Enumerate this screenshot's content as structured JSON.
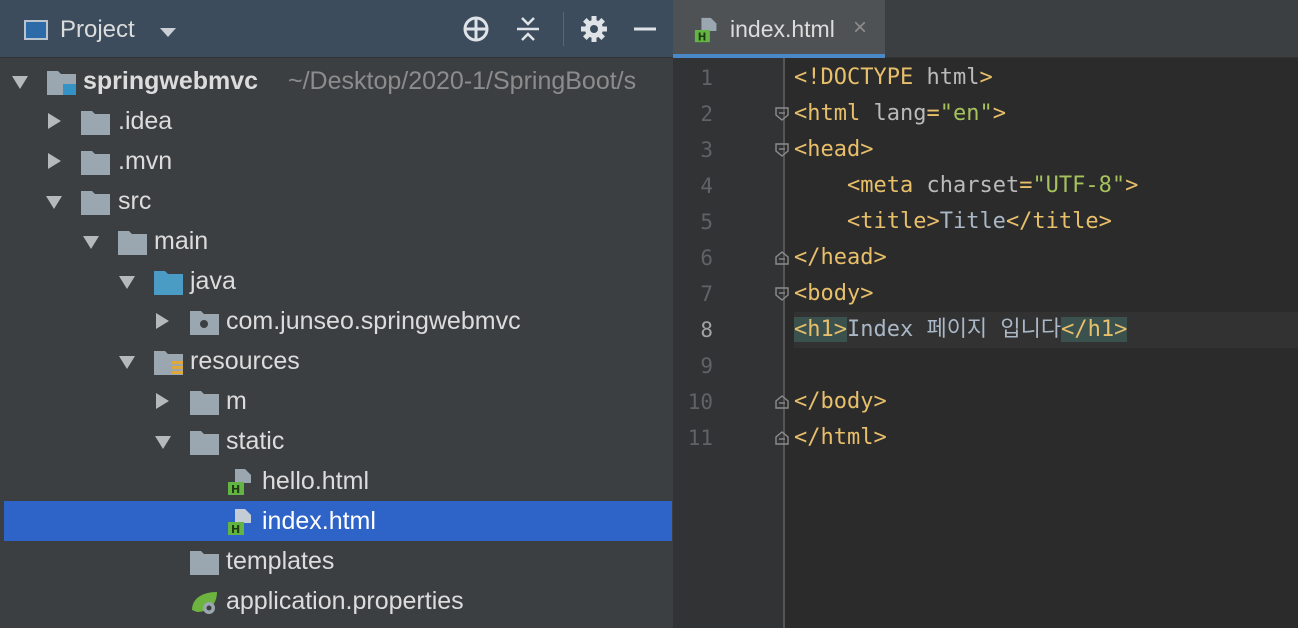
{
  "project_panel": {
    "title": "Project",
    "header_icons": [
      "locate-icon",
      "collapse-all-icon",
      "gear-icon",
      "hide-icon"
    ],
    "tree": [
      {
        "name": "springwebmvc",
        "path": "~/Desktop/2020-1/SpringBoot/s",
        "expanded": true,
        "icon": "module-folder-icon"
      },
      {
        "name": ".idea",
        "expanded": false,
        "icon": "folder-icon"
      },
      {
        "name": ".mvn",
        "expanded": false,
        "icon": "folder-icon"
      },
      {
        "name": "src",
        "expanded": true,
        "icon": "folder-icon"
      },
      {
        "name": "main",
        "expanded": true,
        "icon": "folder-icon"
      },
      {
        "name": "java",
        "expanded": true,
        "icon": "source-folder-icon"
      },
      {
        "name": "com.junseo.springwebmvc",
        "expanded": false,
        "icon": "package-icon"
      },
      {
        "name": "resources",
        "expanded": true,
        "icon": "resources-folder-icon"
      },
      {
        "name": "m",
        "expanded": false,
        "icon": "folder-icon"
      },
      {
        "name": "static",
        "expanded": true,
        "icon": "folder-icon"
      },
      {
        "name": "hello.html",
        "icon": "html-file-icon"
      },
      {
        "name": "index.html",
        "icon": "html-file-icon",
        "selected": true
      },
      {
        "name": "templates",
        "icon": "folder-icon"
      },
      {
        "name": "application.properties",
        "icon": "spring-properties-icon"
      }
    ]
  },
  "editor": {
    "tab": {
      "label": "index.html",
      "close": "×"
    },
    "current_line": 8,
    "lines": [
      {
        "num": "1",
        "tokens": [
          {
            "t": "tag",
            "v": "<!DOCTYPE "
          },
          {
            "t": "attr",
            "v": "html"
          },
          {
            "t": "tag",
            "v": ">"
          }
        ]
      },
      {
        "num": "2",
        "tokens": [
          {
            "t": "tag",
            "v": "<html "
          },
          {
            "t": "attr",
            "v": "lang"
          },
          {
            "t": "tag",
            "v": "="
          },
          {
            "t": "val",
            "v": "\"en\""
          },
          {
            "t": "tag",
            "v": ">"
          }
        ]
      },
      {
        "num": "3",
        "tokens": [
          {
            "t": "tag",
            "v": "<head>"
          }
        ]
      },
      {
        "num": "4",
        "tokens": [
          {
            "t": "text",
            "v": "    "
          },
          {
            "t": "tag",
            "v": "<meta "
          },
          {
            "t": "attr",
            "v": "charset"
          },
          {
            "t": "tag",
            "v": "="
          },
          {
            "t": "val",
            "v": "\"UTF-8\""
          },
          {
            "t": "tag",
            "v": ">"
          }
        ]
      },
      {
        "num": "5",
        "tokens": [
          {
            "t": "text",
            "v": "    "
          },
          {
            "t": "tag",
            "v": "<title>"
          },
          {
            "t": "text",
            "v": "Title"
          },
          {
            "t": "tag",
            "v": "</title>"
          }
        ]
      },
      {
        "num": "6",
        "tokens": [
          {
            "t": "tag",
            "v": "</head>"
          }
        ]
      },
      {
        "num": "7",
        "tokens": [
          {
            "t": "tag",
            "v": "<body>"
          }
        ]
      },
      {
        "num": "8",
        "tokens": [
          {
            "t": "match",
            "v": "<h1>"
          },
          {
            "t": "text",
            "v": "Index 페이지 입니다"
          },
          {
            "t": "match",
            "v": "</h1>"
          }
        ]
      },
      {
        "num": "9",
        "tokens": []
      },
      {
        "num": "10",
        "tokens": [
          {
            "t": "tag",
            "v": "</body>"
          }
        ]
      },
      {
        "num": "11",
        "tokens": [
          {
            "t": "tag",
            "v": "</html>"
          }
        ]
      }
    ],
    "fold_markers": {
      "2": "open",
      "3": "open",
      "6": "close",
      "7": "open",
      "10": "close",
      "11": "close"
    }
  },
  "colors": {
    "tag": "#e8bf6a",
    "attribute": "#bababa",
    "value": "#a5c25c",
    "text": "#a9b7c6",
    "selection": "#2e63c7"
  }
}
